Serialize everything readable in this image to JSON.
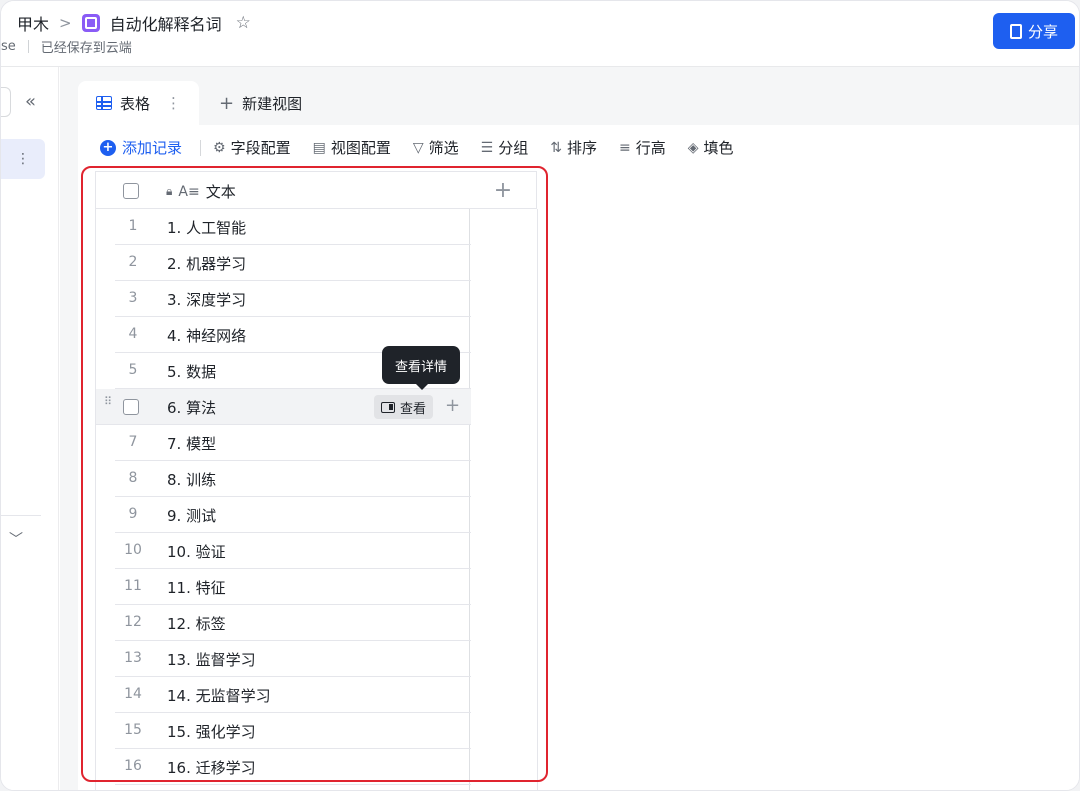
{
  "header": {
    "breadcrumb_parent": "甲木",
    "breadcrumb_sep": ">",
    "doc_title": "自动化解释名词",
    "star_icon": "star-icon",
    "sub_prefix": "se",
    "save_status": "已经保存到云端",
    "share_label": "分享"
  },
  "sidebar": {
    "collapse_glyph": "«",
    "item_more": "⋮",
    "chevron": "﹀"
  },
  "tabs": {
    "active_label": "表格",
    "active_more": "⋮",
    "new_view_label": "新建视图"
  },
  "toolbar": {
    "add_record": "添加记录",
    "field_config": "字段配置",
    "view_config": "视图配置",
    "filter": "筛选",
    "group": "分组",
    "sort": "排序",
    "row_height": "行高",
    "fill_color": "填色"
  },
  "table": {
    "column_header": "文本",
    "add_column": "+",
    "rows": [
      {
        "num": "1",
        "text": "1. 人工智能"
      },
      {
        "num": "2",
        "text": "2. 机器学习"
      },
      {
        "num": "3",
        "text": "3. 深度学习"
      },
      {
        "num": "4",
        "text": "4. 神经网络"
      },
      {
        "num": "5",
        "text": "5. 数据"
      },
      {
        "num": "6",
        "text": "6. 算法"
      },
      {
        "num": "7",
        "text": "7. 模型"
      },
      {
        "num": "8",
        "text": "8. 训练"
      },
      {
        "num": "9",
        "text": "9. 测试"
      },
      {
        "num": "10",
        "text": "10. 验证"
      },
      {
        "num": "11",
        "text": "11. 特征"
      },
      {
        "num": "12",
        "text": "12. 标签"
      },
      {
        "num": "13",
        "text": "13. 监督学习"
      },
      {
        "num": "14",
        "text": "14. 无监督学习"
      },
      {
        "num": "15",
        "text": "15. 强化学习"
      },
      {
        "num": "16",
        "text": "16. 迁移学习"
      }
    ],
    "view_button": "查看",
    "tooltip": "查看详情",
    "hovered_row": 6
  },
  "colors": {
    "accent": "#1e5ff0",
    "highlight": "#e0242f",
    "app_icon": "#8a5cf6"
  }
}
